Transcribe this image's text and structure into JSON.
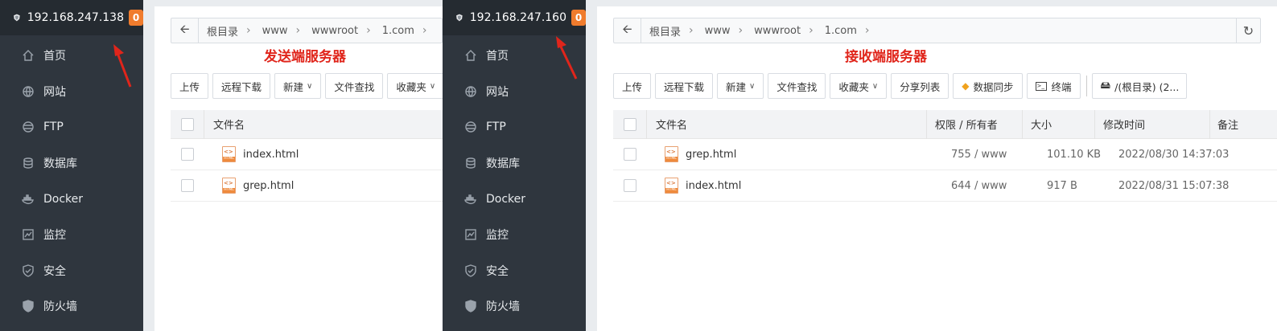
{
  "left": {
    "server_ip": "192.168.247.138",
    "badge_count": "0",
    "menu": [
      {
        "label": "首页",
        "icon": "home-icon"
      },
      {
        "label": "网站",
        "icon": "globe-icon"
      },
      {
        "label": "FTP",
        "icon": "ftp-icon"
      },
      {
        "label": "数据库",
        "icon": "database-icon"
      },
      {
        "label": "Docker",
        "icon": "docker-icon"
      },
      {
        "label": "监控",
        "icon": "monitor-icon"
      },
      {
        "label": "安全",
        "icon": "shield-icon"
      },
      {
        "label": "防火墙",
        "icon": "firewall-icon"
      }
    ],
    "breadcrumb": [
      "根目录",
      "www",
      "wwwroot",
      "1.com"
    ],
    "annotation": "发送端服务器",
    "toolbar": [
      "上传",
      "远程下载",
      "新建",
      "文件查找",
      "收藏夹"
    ],
    "table_header": {
      "name": "文件名"
    },
    "files": [
      {
        "name": "index.html"
      },
      {
        "name": "grep.html"
      }
    ]
  },
  "right": {
    "server_ip": "192.168.247.160",
    "badge_count": "0",
    "menu": [
      {
        "label": "首页",
        "icon": "home-icon"
      },
      {
        "label": "网站",
        "icon": "globe-icon"
      },
      {
        "label": "FTP",
        "icon": "ftp-icon"
      },
      {
        "label": "数据库",
        "icon": "database-icon"
      },
      {
        "label": "Docker",
        "icon": "docker-icon"
      },
      {
        "label": "监控",
        "icon": "monitor-icon"
      },
      {
        "label": "安全",
        "icon": "shield-icon"
      },
      {
        "label": "防火墙",
        "icon": "firewall-icon"
      }
    ],
    "breadcrumb": [
      "根目录",
      "www",
      "wwwroot",
      "1.com"
    ],
    "annotation": "接收端服务器",
    "toolbar": [
      "上传",
      "远程下载",
      "新建",
      "文件查找",
      "收藏夹",
      "分享列表",
      "数据同步",
      "终端",
      "/(根目录) (2..."
    ],
    "table_header": {
      "name": "文件名",
      "perm": "权限 / 所有者",
      "size": "大小",
      "mtime": "修改时间",
      "note": "备注"
    },
    "files": [
      {
        "name": "grep.html",
        "perm": "755 / www",
        "size": "101.10 KB",
        "mtime": "2022/08/30 14:37:03"
      },
      {
        "name": "index.html",
        "perm": "644 / www",
        "size": "917 B",
        "mtime": "2022/08/31 15:07:38"
      }
    ]
  },
  "colors": {
    "sidebar": "#2f363e",
    "badge": "#f07c2d",
    "annotation": "#e0251b"
  }
}
